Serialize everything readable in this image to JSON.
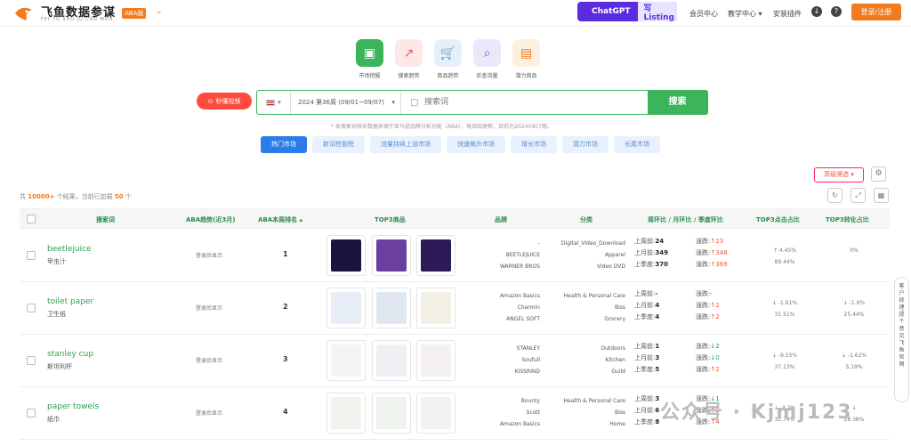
{
  "header": {
    "brand": "飞鱼数据参谋",
    "brand_sub": "FEI YU SHU JU CAN MOU",
    "badge": "ABA版",
    "gpt_a": "ChatGPT",
    "gpt_b": "写Listing",
    "nav": [
      "会员中心",
      "教学中心 ▾",
      "安装插件"
    ],
    "help": "?",
    "login": "登录/注册"
  },
  "tools": [
    "市场挖掘",
    "搜索趋势",
    "商品趋势",
    "反查流量",
    "潜力商品"
  ],
  "search": {
    "video": "秒懂视频",
    "flag": "▾",
    "week": "2024 第36周 (09/01~09/07)",
    "placeholder": "搜索词",
    "button": "搜索"
  },
  "note": "* 本搜索词排名数据来源于亚马逊品牌分析功能（ABA），每周四更新，目前为20240907期。",
  "market_tabs": [
    "热门市场",
    "新词挖掘榜",
    "流量持续上涨市场",
    "快速飙升市场",
    "增长市场",
    "潜力市场",
    "长尾市场"
  ],
  "filter": "高级筛选 ▾",
  "count": {
    "pre": "共",
    "total": "10000+",
    "mid": "个结果，当前已加载",
    "loaded": "50",
    "post": "个"
  },
  "columns": [
    "搜索词",
    "ABA趋势(近3月)",
    "ABA本周排名 ▴",
    "TOP3商品",
    "品牌",
    "分类",
    "周环比 / 月环比 / 季度环比",
    "TOP3点击占比",
    "TOP3转化占比"
  ],
  "rows": [
    {
      "en": "beetlejuice",
      "cn": "甲虫汁",
      "aba": "登录后显示",
      "rank": "1",
      "brands": [
        "-",
        "BEETLEJUICE",
        "WARNER BROS"
      ],
      "cats": [
        "Digital_Video_Download",
        "Apparel",
        "Video DVD"
      ],
      "prev": [
        [
          "上周前:",
          "24"
        ],
        [
          "上月前:",
          "349"
        ],
        [
          "上季度:",
          "370"
        ]
      ],
      "chg": [
        [
          "涨跌:",
          "↑",
          "23",
          "up"
        ],
        [
          "涨跌:",
          "↑",
          "348",
          "up"
        ],
        [
          "涨跌:",
          "↑",
          "369",
          "up"
        ]
      ],
      "clk": [
        "↑",
        "4.45%",
        "89.44%",
        "up"
      ],
      "cvr": [
        "",
        "",
        "0%",
        ""
      ]
    },
    {
      "en": "toilet paper",
      "cn": "卫生纸",
      "aba": "登录后显示",
      "rank": "2",
      "brands": [
        "Amazon Basics",
        "Charmin",
        "ANGEL SOFT"
      ],
      "cats": [
        "Health & Personal Care",
        "Biss",
        "Grocery"
      ],
      "prev": [
        [
          "上周前:",
          "-"
        ],
        [
          "上月前:",
          "4"
        ],
        [
          "上季度:",
          "4"
        ]
      ],
      "chg": [
        [
          "涨跌:",
          "",
          "-",
          ""
        ],
        [
          "涨跌:",
          "↑",
          "2",
          "up"
        ],
        [
          "涨跌:",
          "↑",
          "2",
          "up"
        ]
      ],
      "clk": [
        "↓",
        "-1.61%",
        "31.51%",
        "dn"
      ],
      "cvr": [
        "↓",
        "-1.9%",
        "25.44%",
        "dn"
      ]
    },
    {
      "en": "stanley cup",
      "cn": "斯坦利杯",
      "aba": "登录后显示",
      "rank": "3",
      "brands": [
        "STANLEY",
        "Soufull",
        "KISSRIND"
      ],
      "cats": [
        "Outdoors",
        "Kitchen",
        "Guild"
      ],
      "prev": [
        [
          "上周前:",
          "1"
        ],
        [
          "上月前:",
          "3"
        ],
        [
          "上季度:",
          "5"
        ]
      ],
      "chg": [
        [
          "涨跌:",
          "↓",
          "2",
          "dn"
        ],
        [
          "涨跌:",
          "↓",
          "0",
          "dn"
        ],
        [
          "涨跌:",
          "↑",
          "2",
          "up"
        ]
      ],
      "clk": [
        "↓",
        "-9.55%",
        "37.13%",
        "dn"
      ],
      "cvr": [
        "↓",
        "-1.62%",
        "5.19%",
        "dn"
      ]
    },
    {
      "en": "paper towels",
      "cn": "纸巾",
      "aba": "登录后显示",
      "rank": "4",
      "brands": [
        "Bounty",
        "Scott",
        "Amazon Basics"
      ],
      "cats": [
        "Health & Personal Care",
        "Biss",
        "Home"
      ],
      "prev": [
        [
          "上周前:",
          "3"
        ],
        [
          "上月前:",
          "6"
        ],
        [
          "上季度:",
          "8"
        ]
      ],
      "chg": [
        [
          "涨跌:",
          "↓",
          "1",
          "dn"
        ],
        [
          "涨跌:",
          "↑",
          "2",
          "up"
        ],
        [
          "涨跌:",
          "↑",
          "4",
          "up"
        ]
      ],
      "clk": [
        "↓",
        "-4.2%",
        "32.74%",
        "dn"
      ],
      "cvr": [
        "↓",
        "",
        "28.38%",
        "dn"
      ]
    }
  ],
  "side": [
    "客",
    "户",
    "经",
    "理",
    "提",
    "个",
    "意",
    "见",
    "飞",
    "鱼",
    "官",
    "网"
  ],
  "watermark": "公众号 · Kjmj123",
  "colors": {
    "accent": "#3cb45b",
    "orange": "#f37b1d",
    "purple": "#5b2be0",
    "blue": "#2a7ce8"
  }
}
